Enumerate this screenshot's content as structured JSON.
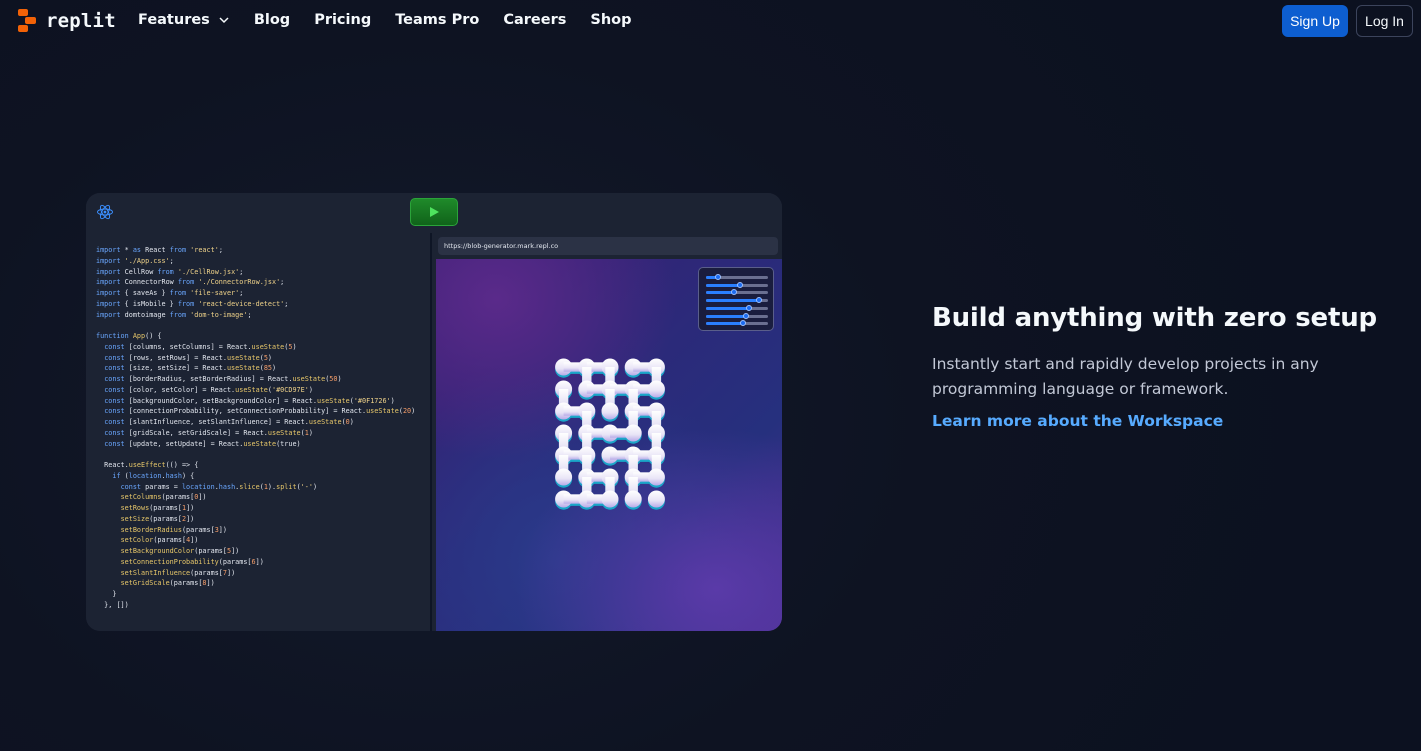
{
  "brand": {
    "name": "replit",
    "color": "#f26207"
  },
  "nav": {
    "items": [
      {
        "label": "Features",
        "has_dropdown": true
      },
      {
        "label": "Blog"
      },
      {
        "label": "Pricing"
      },
      {
        "label": "Teams Pro"
      },
      {
        "label": "Careers"
      },
      {
        "label": "Shop"
      }
    ],
    "signup_label": "Sign Up",
    "login_label": "Log In"
  },
  "workspace": {
    "url": "https://blob-generator.mark.repl.co",
    "code_lines": [
      "import * as React from 'react';",
      "import './App.css';",
      "import CellRow from './CellRow.jsx';",
      "import ConnectorRow from './ConnectorRow.jsx';",
      "import { saveAs } from 'file-saver';",
      "import { isMobile } from 'react-device-detect';",
      "import domtoimage from 'dom-to-image';",
      "",
      "function App() {",
      "  const [columns, setColumns] = React.useState(5)",
      "  const [rows, setRows] = React.useState(5)",
      "  const [size, setSize] = React.useState(85)",
      "  const [borderRadius, setBorderRadius] = React.useState(50)",
      "  const [color, setColor] = React.useState('#0CD97E')",
      "  const [backgroundColor, setBackgroundColor] = React.useState('#0F1726')",
      "  const [connectionProbability, setConnectionProbability] = React.useState(20)",
      "  const [slantInfluence, setSlantInfluence] = React.useState(0)",
      "  const [gridScale, setGridScale] = React.useState(1)",
      "  const [update, setUpdate] = React.useState(true)",
      "",
      "  React.useEffect(() => {",
      "    if (location.hash) {",
      "      const params = location.hash.slice(1).split('-')",
      "      setColumns(params[0])",
      "      setRows(params[1])",
      "      setSize(params[2])",
      "      setBorderRadius(params[3])",
      "      setColor(params[4])",
      "      setBackgroundColor(params[5])",
      "      setConnectionProbability(params[6])",
      "      setSlantInfluence(params[7])",
      "      setGridScale(params[8])",
      "    }",
      "  }, [])"
    ],
    "sliders": [
      0.2,
      0.55,
      0.45,
      0.85,
      0.7,
      0.65,
      0.6
    ],
    "blob_grid": {
      "columns": 5,
      "rows": 7
    }
  },
  "hero": {
    "title": "Build anything with zero setup",
    "description": "Instantly start and rapidly develop projects in any programming language or framework.",
    "link": "Learn more about the Workspace"
  }
}
